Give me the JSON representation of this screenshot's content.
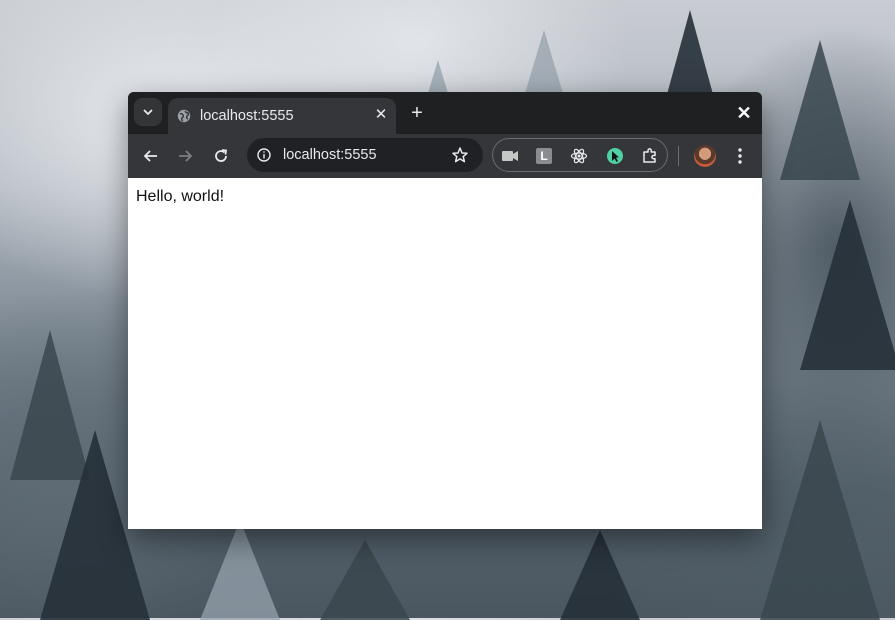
{
  "browser": {
    "tab": {
      "title": "localhost:5555",
      "icon": "globe-icon"
    },
    "toolbar": {
      "url": "localhost:5555",
      "icons": [
        "back-arrow-icon",
        "forward-arrow-icon",
        "reload-icon",
        "site-info-icon",
        "bookmark-star-icon"
      ]
    },
    "extensions": {
      "items": [
        "camera-extension-icon",
        "l-extension-icon",
        "react-icon",
        "cursor-extension-icon",
        "extensions-puzzle-icon"
      ],
      "l_label": "L"
    },
    "accent": "#4fd1a5"
  },
  "page": {
    "content_text": "Hello, world!"
  }
}
